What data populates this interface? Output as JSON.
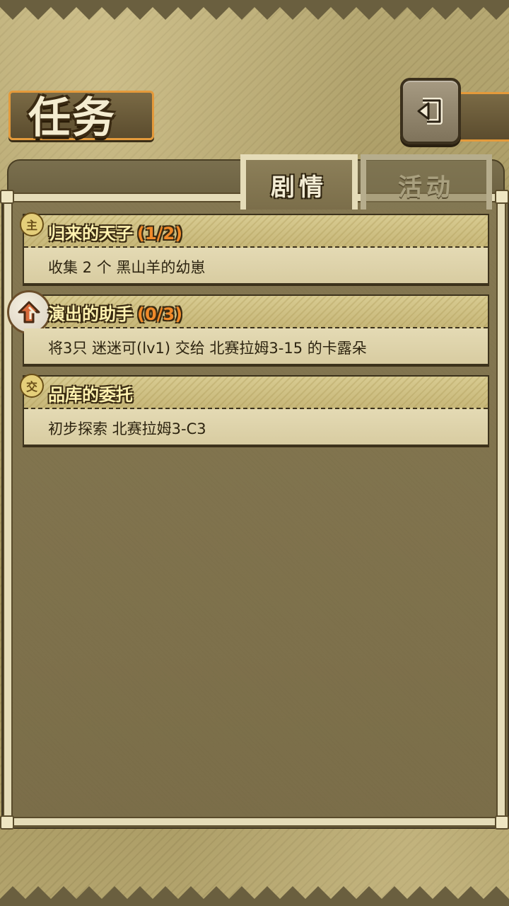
{
  "header": {
    "title": "任务"
  },
  "tabs": [
    {
      "label": "剧情",
      "active": true
    },
    {
      "label": "活动",
      "active": false
    }
  ],
  "quests": [
    {
      "icon": "main-quest-icon",
      "icon_text": "主",
      "title": "归来的天子",
      "progress": "(1/2)",
      "description": "收集 2 个 黑山羊的幼崽"
    },
    {
      "icon": "tracked-quest-arrow-icon",
      "icon_text": "",
      "title": "演出的助手",
      "progress": "(0/3)",
      "description": "将3只 迷迷可(lv1) 交给 北赛拉姆3-15 的卡露朵"
    },
    {
      "icon": "exchange-quest-icon",
      "icon_text": "交",
      "title": "品库的委托",
      "progress": "",
      "description": "初步探索 北赛拉姆3-C3"
    }
  ],
  "colors": {
    "accent_orange": "#e49a3b",
    "progress_orange": "#f08a2a",
    "title_yellow": "#fff2b0",
    "panel_brown": "#7b6e49"
  }
}
